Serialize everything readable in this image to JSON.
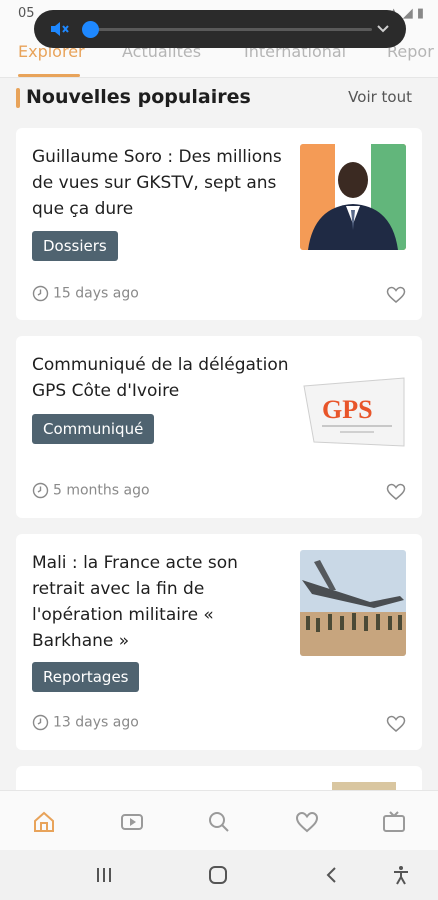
{
  "status_bar": {
    "time": "05"
  },
  "tabs": [
    "Explorer",
    "Actualités",
    "International",
    "Repor"
  ],
  "section": {
    "title": "Nouvelles populaires",
    "see_all": "Voir tout"
  },
  "cards": [
    {
      "title": "Guillaume Soro : Des millions de vues sur GKSTV, sept ans que ça dure",
      "tag": "Dossiers",
      "time": "15 days ago",
      "image": "portrait-photo"
    },
    {
      "title": "Communiqué de la délégation GPS Côte d'Ivoire",
      "tag": "Communiqué",
      "time": "5 months ago",
      "image": "gps-logo",
      "image_logo_text": "GPS"
    },
    {
      "title": "Mali : la France acte son retrait avec la fin de l'opération militaire « Barkhane »",
      "tag": "Reportages",
      "time": "13 days ago",
      "image": "military-aircraft-photo"
    }
  ],
  "bottom_nav": [
    "home-icon",
    "video-icon",
    "search-icon",
    "heart-icon",
    "tv-icon"
  ],
  "colors": {
    "accent": "#e8a35a",
    "tag_bg": "#4f6370",
    "volume_knob": "#1e88ff"
  }
}
